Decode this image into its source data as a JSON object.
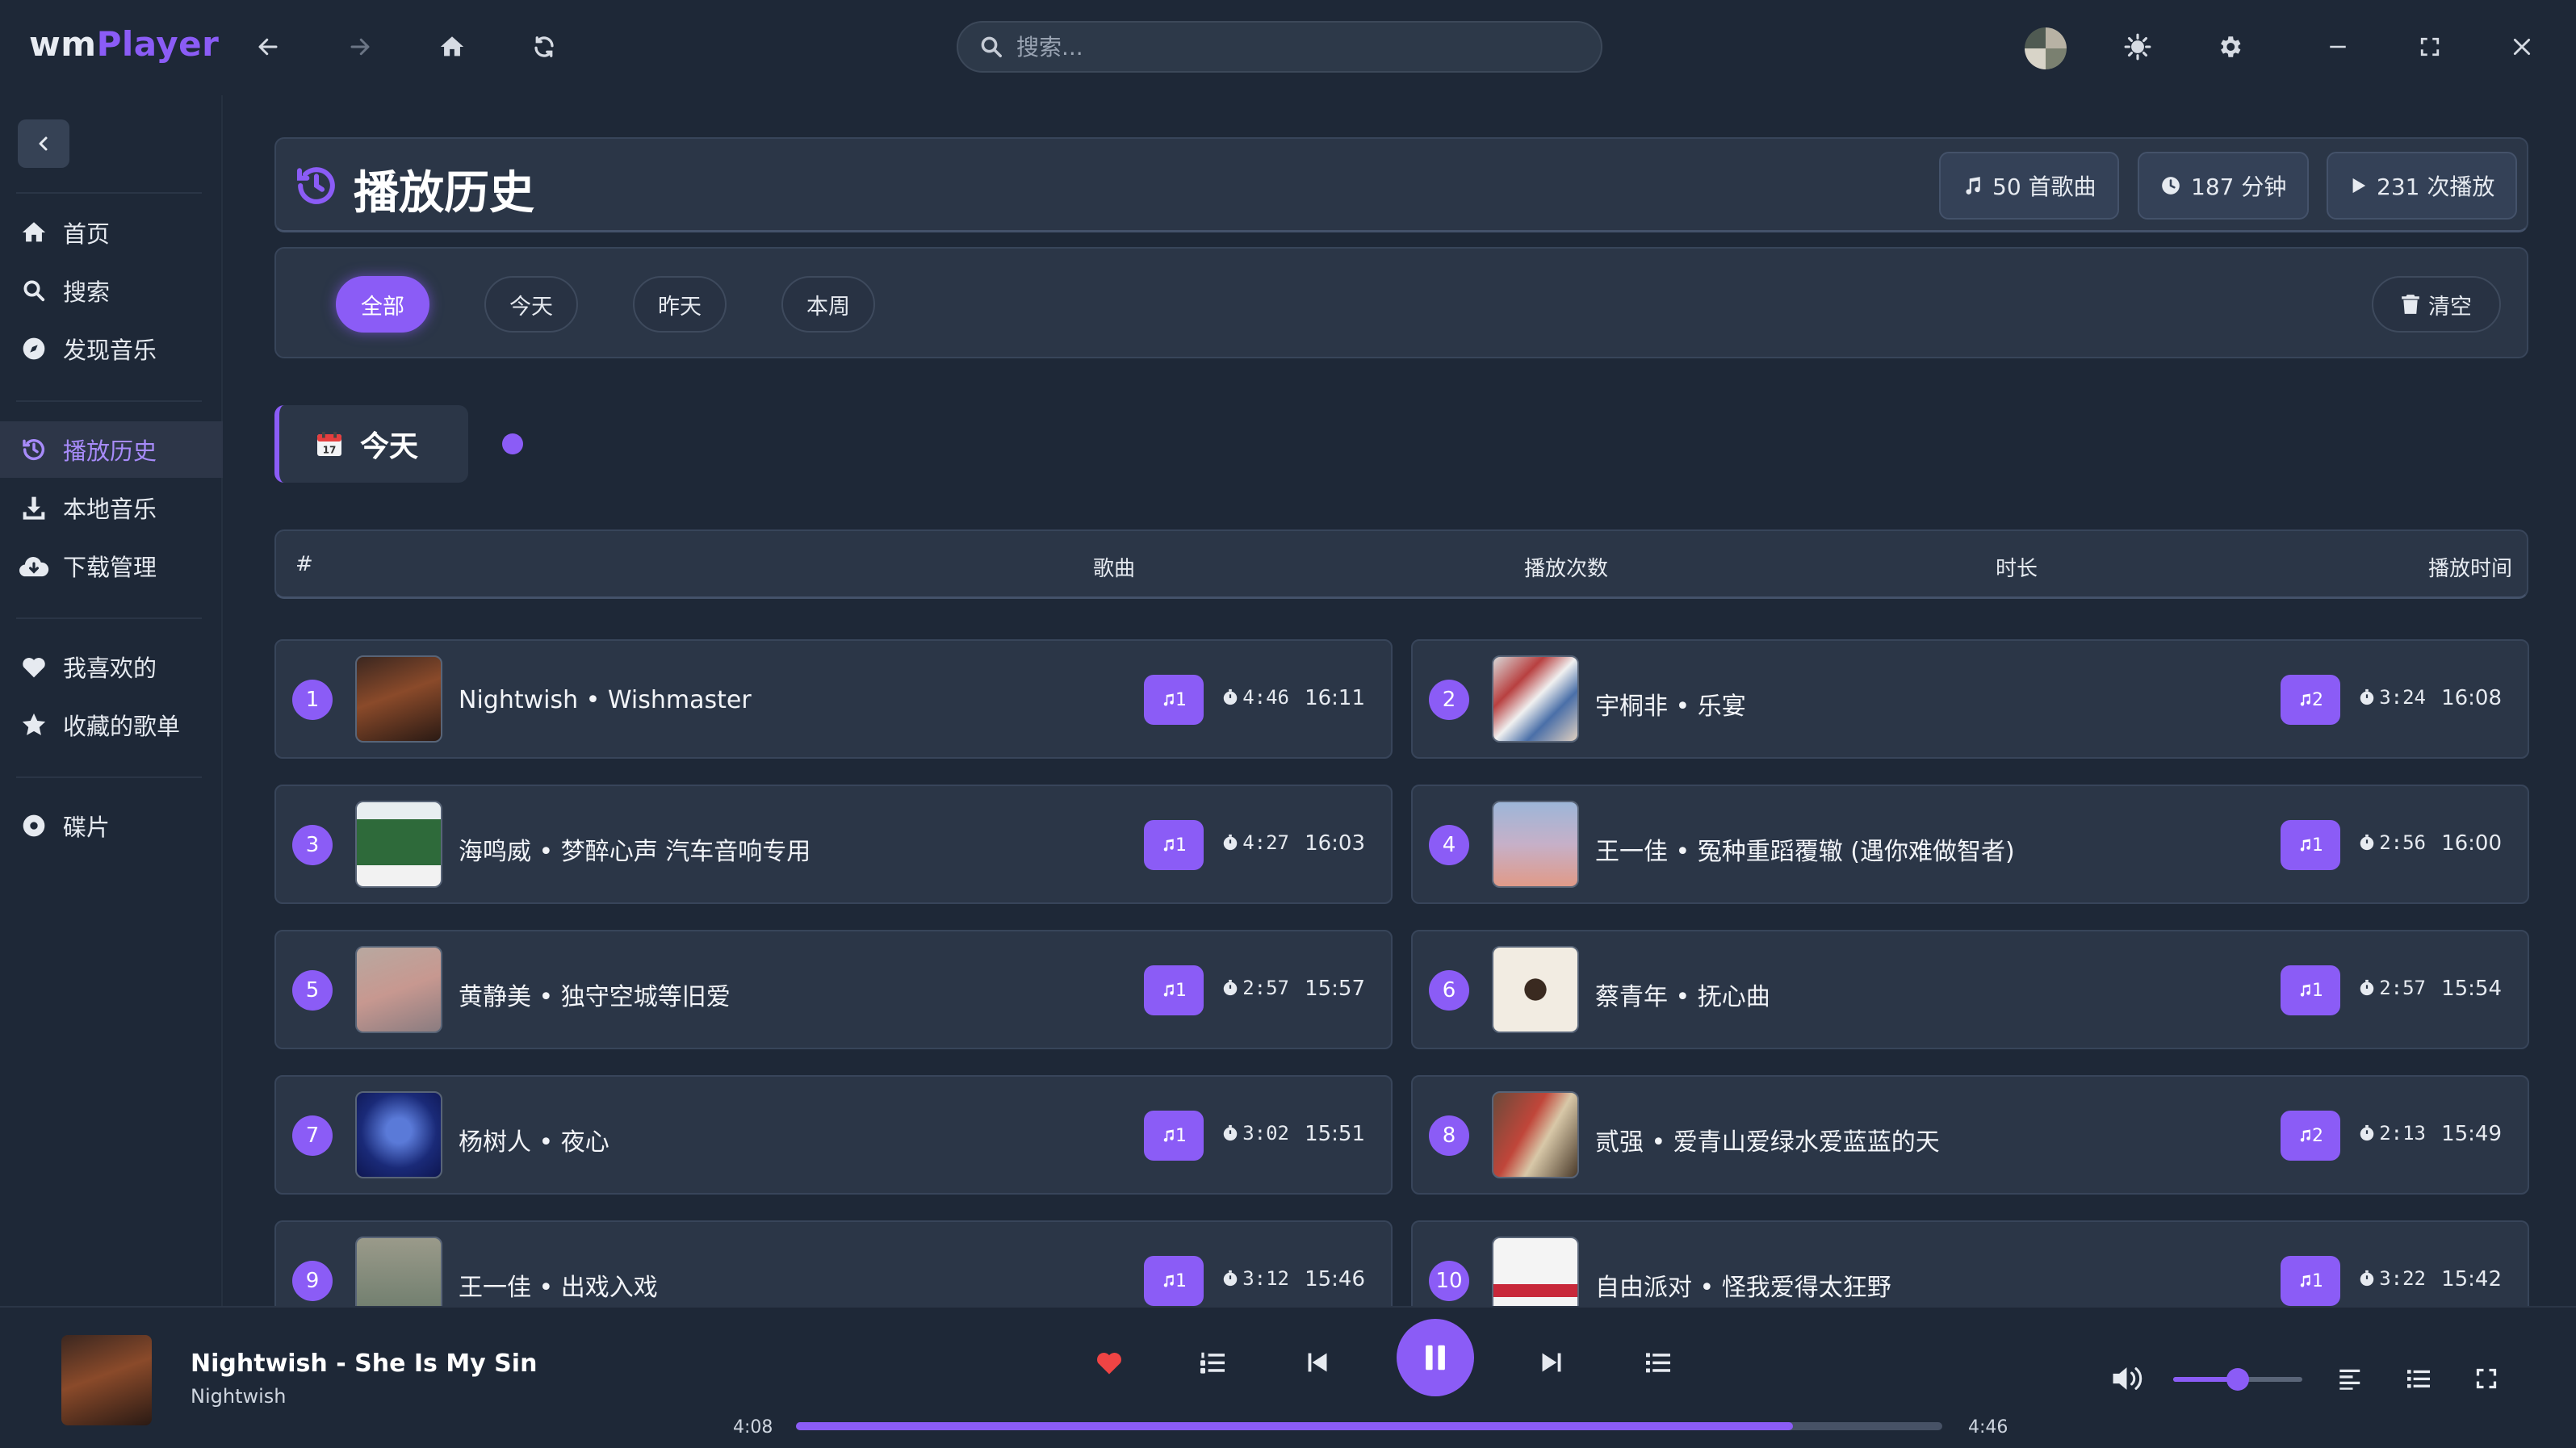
{
  "app": {
    "logo_prefix": "wm",
    "logo_suffix": "Player",
    "search_placeholder": "搜索..."
  },
  "sidebar": {
    "items": [
      {
        "label": "首页",
        "icon": "home-icon"
      },
      {
        "label": "搜索",
        "icon": "search-icon"
      },
      {
        "label": "发现音乐",
        "icon": "compass-icon"
      },
      {
        "label": "播放历史",
        "icon": "history-icon",
        "active": true
      },
      {
        "label": "本地音乐",
        "icon": "download-icon"
      },
      {
        "label": "下载管理",
        "icon": "cloud-download-icon"
      },
      {
        "label": "我喜欢的",
        "icon": "heart-icon"
      },
      {
        "label": "收藏的歌单",
        "icon": "star-icon"
      },
      {
        "label": "碟片",
        "icon": "disc-icon"
      }
    ]
  },
  "page": {
    "title": "播放历史",
    "stats": {
      "songs": "50 首歌曲",
      "minutes": "187 分钟",
      "plays": "231 次播放"
    },
    "filters": [
      "全部",
      "今天",
      "昨天",
      "本周"
    ],
    "active_filter": "全部",
    "clear_label": "清空",
    "section_label": "今天"
  },
  "table": {
    "headers": {
      "index": "#",
      "song": "歌曲",
      "plays": "播放次数",
      "duration": "时长",
      "time": "播放时间"
    }
  },
  "songs": [
    {
      "n": "1",
      "title": "Nightwish • Wishmaster",
      "count": "1",
      "duration": "4:46",
      "time": "16:11"
    },
    {
      "n": "2",
      "title": "宇桐非 • 乐宴",
      "count": "2",
      "duration": "3:24",
      "time": "16:08"
    },
    {
      "n": "3",
      "title": "海鸣威 • 梦醉心声 汽车音响专用",
      "count": "1",
      "duration": "4:27",
      "time": "16:03"
    },
    {
      "n": "4",
      "title": "王一佳 • 冤种重蹈覆辙 (遇你难做智者)",
      "count": "1",
      "duration": "2:56",
      "time": "16:00"
    },
    {
      "n": "5",
      "title": "黄静美 • 独守空城等旧爱",
      "count": "1",
      "duration": "2:57",
      "time": "15:57"
    },
    {
      "n": "6",
      "title": "蔡青年 • 抚心曲",
      "count": "1",
      "duration": "2:57",
      "time": "15:54"
    },
    {
      "n": "7",
      "title": "杨树人 • 夜心",
      "count": "1",
      "duration": "3:02",
      "time": "15:51"
    },
    {
      "n": "8",
      "title": "贰强 • 爱青山爱绿水爱蓝蓝的天",
      "count": "2",
      "duration": "2:13",
      "time": "15:49"
    },
    {
      "n": "9",
      "title": "王一佳 • 出戏入戏",
      "count": "1",
      "duration": "3:12",
      "time": "15:46"
    },
    {
      "n": "10",
      "title": "自由派对 • 怪我爱得太狂野",
      "count": "1",
      "duration": "3:22",
      "time": "15:42"
    }
  ],
  "player": {
    "title": "Nightwish - She Is My Sin",
    "artist": "Nightwish",
    "elapsed": "4:08",
    "total": "4:46",
    "progress_percent": 87,
    "volume_percent": 50
  },
  "colors": {
    "accent": "#8b5cf6",
    "background": "#1e2837",
    "panel": "#2b3647",
    "like": "#ef4444"
  }
}
